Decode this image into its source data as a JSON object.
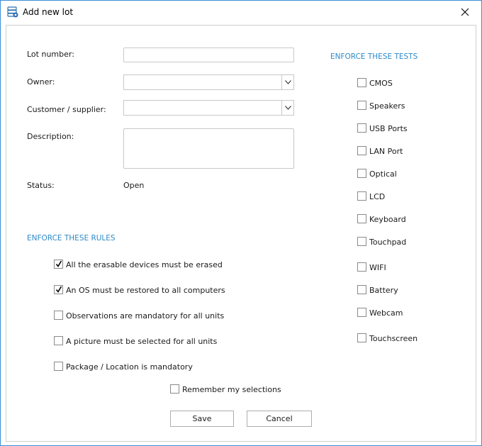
{
  "window": {
    "title": "Add new lot"
  },
  "form": {
    "lot_number_label": "Lot number:",
    "lot_number_value": "",
    "owner_label": "Owner:",
    "owner_value": "",
    "customer_label": "Customer / supplier:",
    "customer_value": "",
    "description_label": "Description:",
    "description_value": "",
    "status_label": "Status:",
    "status_value": "Open"
  },
  "rules": {
    "heading": "ENFORCE THESE RULES",
    "items": [
      {
        "label": "All the erasable devices must be erased",
        "checked": true
      },
      {
        "label": "An OS must be restored to all computers",
        "checked": true
      },
      {
        "label": "Observations are mandatory for all units",
        "checked": false
      },
      {
        "label": "A picture must be selected for all units",
        "checked": false
      },
      {
        "label": "Package / Location is mandatory",
        "checked": false
      }
    ]
  },
  "tests": {
    "heading": "ENFORCE THESE TESTS",
    "items": [
      {
        "label": "CMOS",
        "checked": false
      },
      {
        "label": "Speakers",
        "checked": false
      },
      {
        "label": "USB Ports",
        "checked": false
      },
      {
        "label": "LAN Port",
        "checked": false
      },
      {
        "label": "Optical",
        "checked": false
      },
      {
        "label": "LCD",
        "checked": false
      },
      {
        "label": "Keyboard",
        "checked": false
      },
      {
        "label": "Touchpad",
        "checked": false
      },
      {
        "label": "WIFI",
        "checked": false
      },
      {
        "label": "Battery",
        "checked": false
      },
      {
        "label": "Webcam",
        "checked": false
      },
      {
        "label": "Touchscreen",
        "checked": false
      }
    ]
  },
  "remember": {
    "label": "Remember my selections",
    "checked": false
  },
  "buttons": {
    "save": "Save",
    "cancel": "Cancel"
  }
}
